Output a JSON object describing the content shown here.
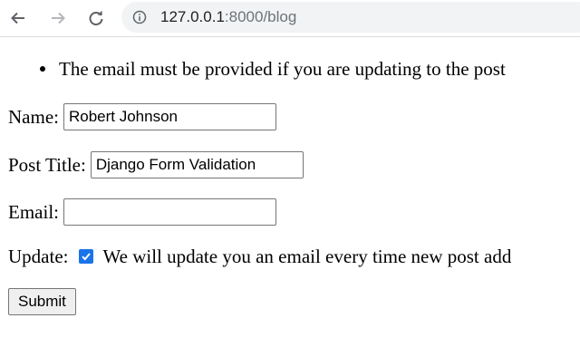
{
  "browser": {
    "url_host": "127.0.0.1",
    "url_path": ":8000/blog",
    "icons": [
      "back-arrow-icon",
      "forward-arrow-icon",
      "reload-icon",
      "info-icon"
    ]
  },
  "errors": [
    "The email must be provided if you are updating to the post"
  ],
  "form": {
    "name_label": "Name:",
    "name_value": "Robert Johnson",
    "title_label": "Post Title:",
    "title_value": "Django Form Validation",
    "email_label": "Email:",
    "email_value": "",
    "update_label": "Update:",
    "update_checked": true,
    "update_text": "We will update you an email every time new post add",
    "submit_label": "Submit"
  },
  "colors": {
    "checkbox": "#1a73e8",
    "omnibox_bg": "#f1f3f4"
  }
}
